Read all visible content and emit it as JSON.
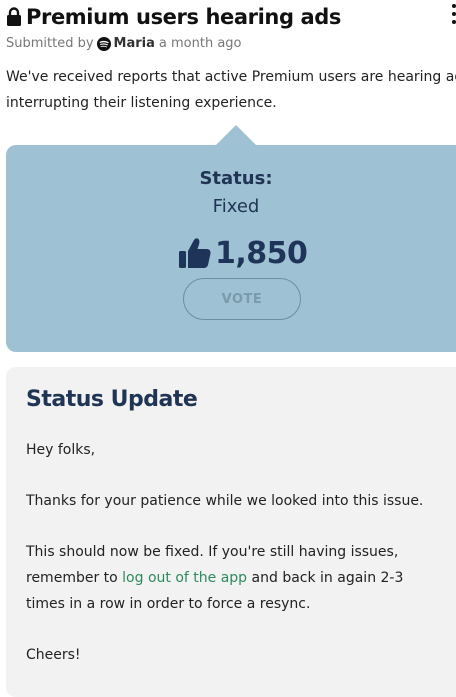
{
  "post": {
    "title": "Premium users hearing ads",
    "submitted_prefix": "Submitted by",
    "author": "Maria",
    "time_ago": "a month ago",
    "description": "We've received reports that active Premium users are hearing ads interrupting their listening experience."
  },
  "status_card": {
    "label": "Status:",
    "value": "Fixed",
    "vote_count": "1,850",
    "vote_button": "VOTE"
  },
  "update": {
    "title": "Status Update",
    "greeting": "Hey folks,",
    "paragraph1": "Thanks for your patience while we looked into this issue.",
    "paragraph2_before": "This should now be fixed. If you're still having issues, remember to",
    "paragraph2_link": "log out of the app",
    "paragraph2_after": "and back in again 2-3 times in a row in order to force a resync.",
    "signoff": "Cheers!"
  },
  "colors": {
    "status_card_bg": "#9ec2d3",
    "status_text": "#203555",
    "link": "#2e8a5e",
    "update_card_bg": "#f2f2f2"
  },
  "icons": {
    "lock": "lock-icon",
    "author_avatar": "spotify-logo-icon",
    "thumb": "thumbs-up-icon",
    "menu": "more-vertical-icon"
  }
}
